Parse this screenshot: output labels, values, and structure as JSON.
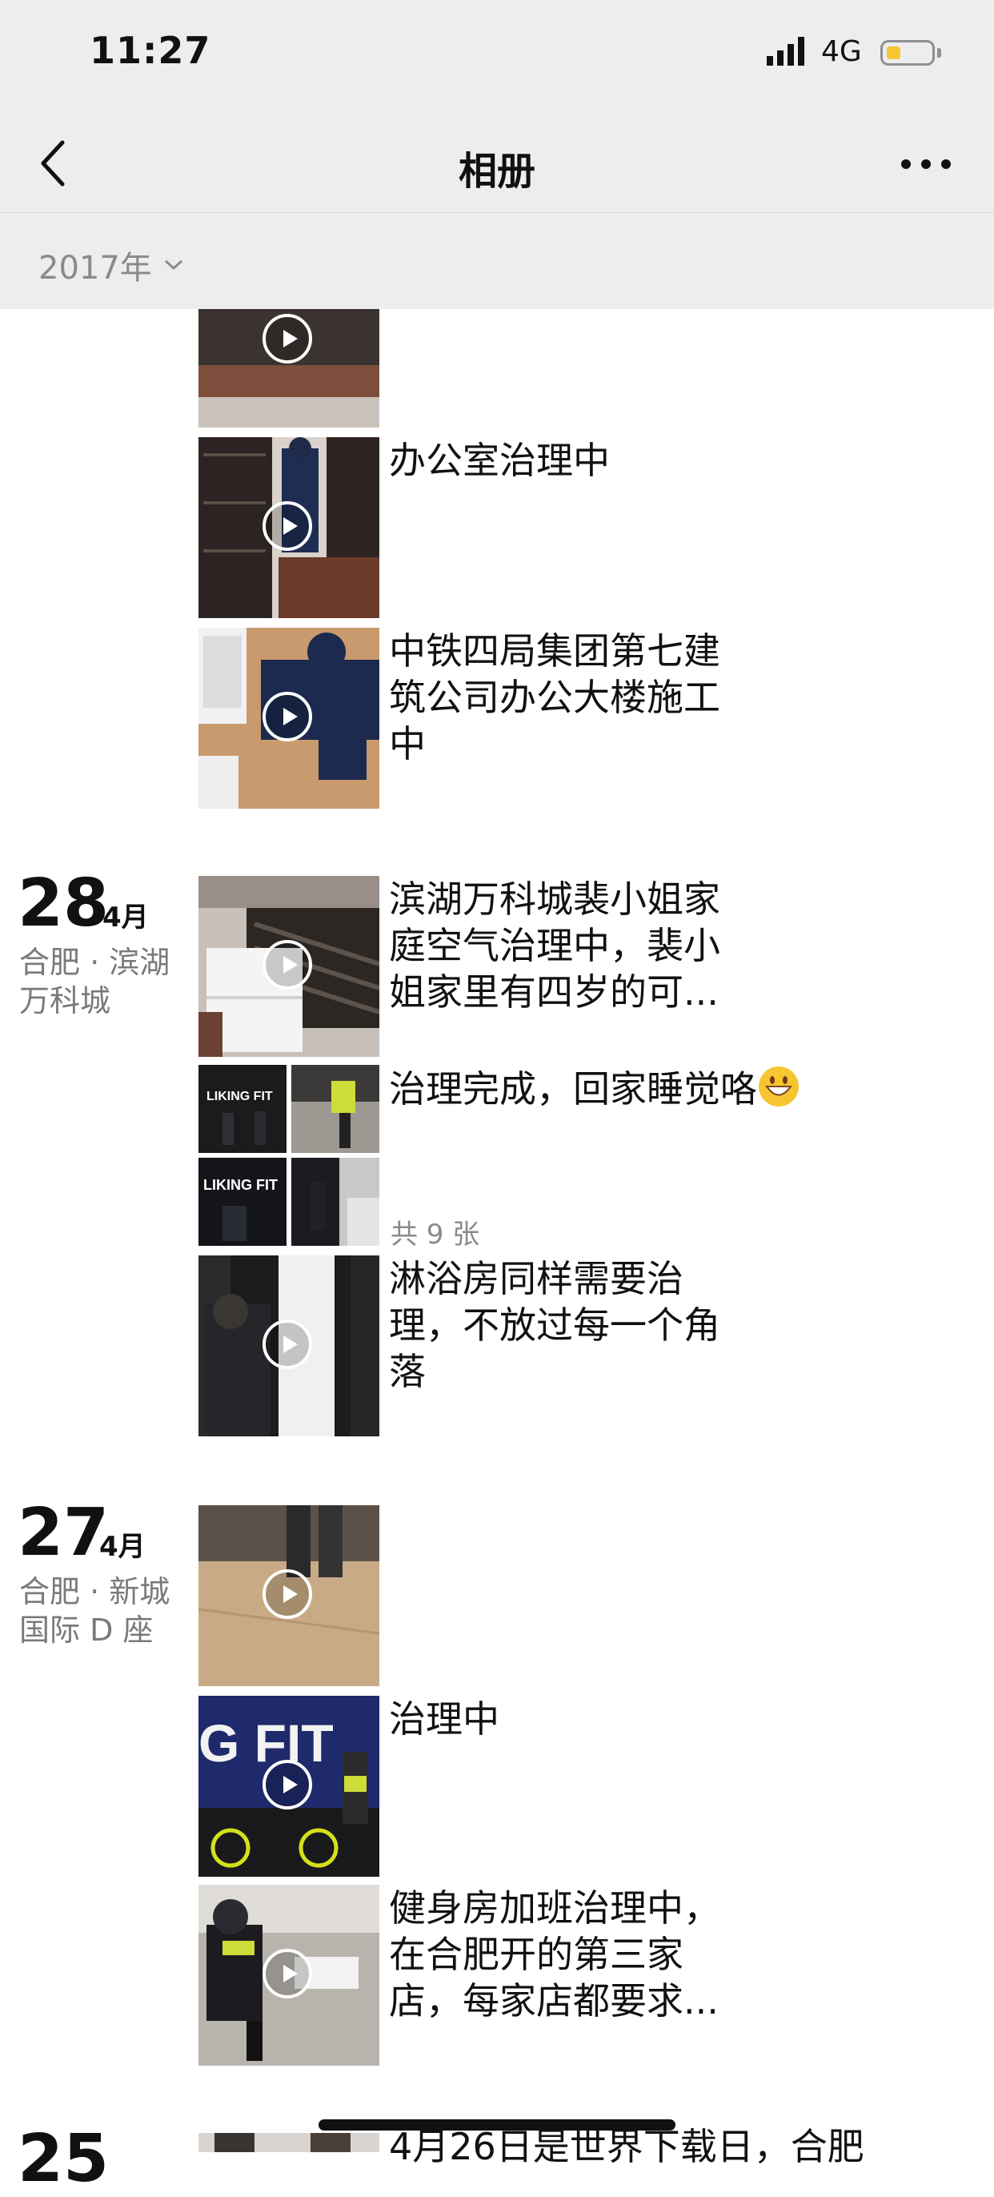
{
  "status_bar": {
    "time": "11:27",
    "network": "4G",
    "battery_level": 0.3
  },
  "nav": {
    "title": "相册",
    "back_icon": "chevron-left-icon",
    "more_icon": "ellipsis-icon"
  },
  "year_filter": {
    "label": "2017年",
    "icon": "chevron-down-icon"
  },
  "posts_top": [
    {
      "text": "",
      "media": "video"
    },
    {
      "text": "办公室治理中",
      "media": "video"
    },
    {
      "text_lines": [
        "中铁四局集团第七建",
        "筑公司办公大楼施工",
        "中"
      ],
      "media": "video"
    }
  ],
  "day_28": {
    "day": "28",
    "month": "4月",
    "location_lines": [
      "合肥 · 滨湖",
      "万科城"
    ],
    "posts": [
      {
        "text_lines": [
          "滨湖万科城裴小姐家",
          "庭空气治理中，裴小",
          "姐家里有四岁的可..."
        ],
        "media": "video"
      },
      {
        "text": "治理完成，回家睡觉咯",
        "emoji": "grinning-face-emoji",
        "photo_count": "共 9 张",
        "media": "photo-grid",
        "thumb_labels": [
          "LIKING FIT",
          "LIKING FIT"
        ]
      },
      {
        "text_lines": [
          "淋浴房同样需要治",
          "理，不放过每一个角",
          "落"
        ],
        "media": "video"
      }
    ]
  },
  "day_27": {
    "day": "27",
    "month": "4月",
    "location_lines": [
      "合肥 · 新城",
      "国际 D 座"
    ],
    "posts": [
      {
        "text": "",
        "media": "video"
      },
      {
        "text": "治理中",
        "media": "video",
        "thumb_label": "G FIT"
      },
      {
        "text_lines": [
          "健身房加班治理中，",
          "在合肥开的第三家",
          "店，每家店都要求..."
        ],
        "media": "video"
      }
    ]
  },
  "day_25": {
    "day": "25",
    "partial_text": "4月26日是世界下载日，合肥"
  }
}
